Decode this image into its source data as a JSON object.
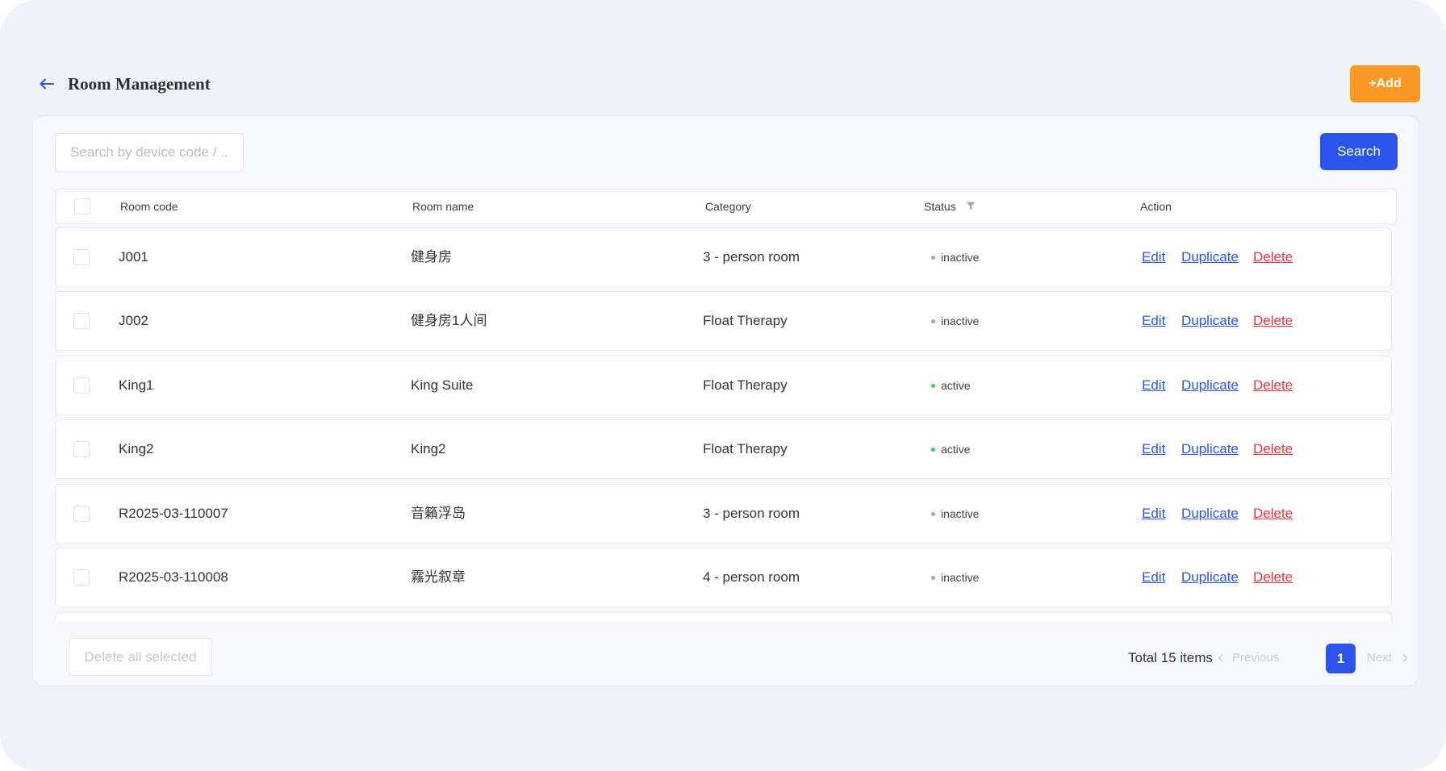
{
  "header": {
    "title": "Room Management",
    "add_label": "+Add"
  },
  "search": {
    "placeholder": "Search by device code / ...",
    "value": "",
    "button_label": "Search"
  },
  "table": {
    "columns": [
      "Room code",
      "Room name",
      "Category",
      "Status",
      "Action"
    ],
    "rows": [
      {
        "code": "J001",
        "name": "健身房",
        "category": "3 - person room",
        "status": "inactive"
      },
      {
        "code": "J002",
        "name": "健身房1人间",
        "category": "Float Therapy",
        "status": "inactive"
      },
      {
        "code": "King1",
        "name": "King Suite",
        "category": "Float Therapy",
        "status": "active"
      },
      {
        "code": "King2",
        "name": "King2",
        "category": "Float Therapy",
        "status": "active"
      },
      {
        "code": "R2025-03-110007",
        "name": "音籟浮岛",
        "category": "3 - person room",
        "status": "inactive"
      },
      {
        "code": "R2025-03-110008",
        "name": "霧光叙章",
        "category": "4 - person room",
        "status": "inactive"
      }
    ],
    "actions": {
      "edit": "Edit",
      "duplicate": "Duplicate",
      "delete": "Delete"
    }
  },
  "footer": {
    "delete_all_label": "Delete all selected",
    "total_label": "Total 15 items",
    "previous_label": "Previous",
    "next_label": "Next",
    "current_page": "1"
  },
  "colors": {
    "accent": "#2a54eb",
    "add": "#fb9a22",
    "danger": "#f0323c",
    "active": "#2ed15a",
    "inactive": "#a3a7ad"
  }
}
